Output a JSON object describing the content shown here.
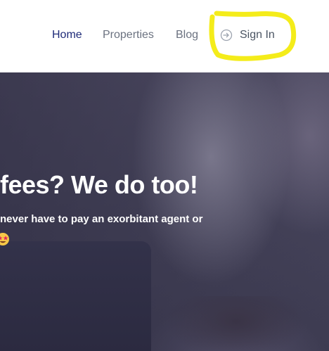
{
  "nav": {
    "home": "Home",
    "properties": "Properties",
    "blog": "Blog",
    "sign_in": "Sign In",
    "active_color": "#1e2a78"
  },
  "hero": {
    "heading": "fees? We do too!",
    "subtext": "never have to pay an exorbitant agent or"
  },
  "annotation": {
    "color": "#f4ec1a"
  },
  "icons": {
    "sign_in": "sign-in-arrow-icon",
    "emoji": "star-eyes-emoji-icon"
  }
}
